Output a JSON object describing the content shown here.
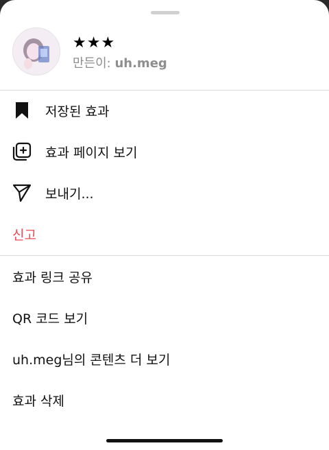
{
  "header": {
    "title": "★★★",
    "creator_prefix": "만든이: ",
    "creator_name": "uh.meg"
  },
  "menu_primary": [
    {
      "label": "저장된 효과",
      "icon": "bookmark-icon"
    },
    {
      "label": "효과 페이지 보기",
      "icon": "effect-page-icon"
    },
    {
      "label": "보내기...",
      "icon": "send-icon"
    },
    {
      "label": "신고",
      "icon": null
    }
  ],
  "menu_secondary": [
    {
      "label": "효과 링크 공유"
    },
    {
      "label": "QR 코드 보기"
    },
    {
      "label": "uh.meg님의 콘텐츠 더 보기"
    },
    {
      "label": "효과 삭제"
    }
  ],
  "colors": {
    "danger": "#ed4956",
    "subtitle": "#8e8e8e",
    "divider": "#dbdbdb"
  }
}
